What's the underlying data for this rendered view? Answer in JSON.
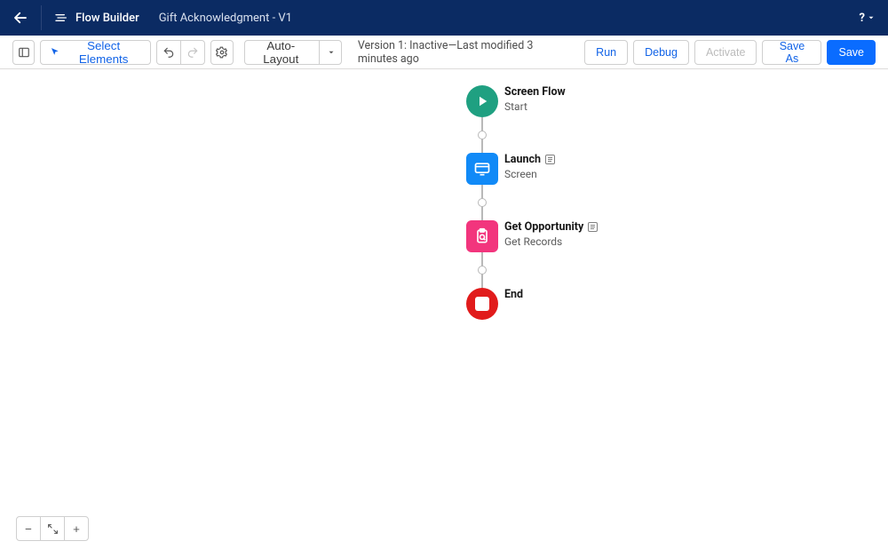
{
  "header": {
    "app": "Flow Builder",
    "title": "Gift Acknowledgment - V1",
    "help": "?"
  },
  "toolbar": {
    "select_elements": "Select Elements",
    "auto_layout": "Auto-Layout",
    "status": "Version 1: Inactive—Last modified 3 minutes ago",
    "run": "Run",
    "debug": "Debug",
    "activate": "Activate",
    "save_as": "Save As",
    "save": "Save"
  },
  "zoom": {
    "out": "−",
    "fit": "",
    "in": "+"
  },
  "flow": [
    {
      "id": "start",
      "title": "Screen Flow",
      "subtitle": "Start",
      "shape": "circle",
      "color": "teal",
      "note": false
    },
    {
      "id": "launch",
      "title": "Launch",
      "subtitle": "Screen",
      "shape": "rounded",
      "color": "blue",
      "note": true
    },
    {
      "id": "getopp",
      "title": "Get Opportunity",
      "subtitle": "Get Records",
      "shape": "rounded",
      "color": "pink",
      "note": true
    },
    {
      "id": "end",
      "title": "End",
      "subtitle": "",
      "shape": "circle",
      "color": "red",
      "note": false
    }
  ]
}
